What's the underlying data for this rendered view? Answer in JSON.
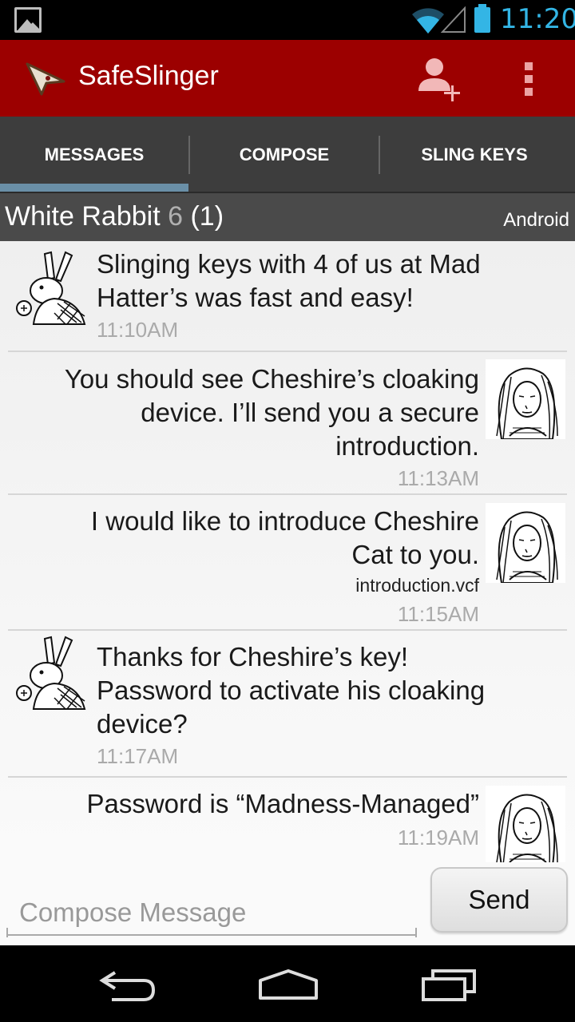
{
  "status_bar": {
    "time": "11:20"
  },
  "action_bar": {
    "title": "SafeSlinger"
  },
  "tabs": [
    {
      "label": "MESSAGES",
      "selected": true
    },
    {
      "label": "COMPOSE",
      "selected": false
    },
    {
      "label": "SLING KEYS",
      "selected": false
    }
  ],
  "recipient": {
    "name": "White Rabbit",
    "count": "6",
    "unread": "(1)",
    "platform": "Android"
  },
  "messages": [
    {
      "direction": "incoming",
      "text_lines": [
        "Slinging keys with 4 of us at Mad",
        "Hatter’s was fast and easy!"
      ],
      "time": "11:10AM"
    },
    {
      "direction": "outgoing",
      "text_lines": [
        "You should see Cheshire’s cloaking",
        "device. I’ll send you a secure",
        "introduction."
      ],
      "time": "11:13AM"
    },
    {
      "direction": "outgoing",
      "text_lines": [
        "I would like to introduce Cheshire",
        "Cat to you."
      ],
      "attachment": "introduction.vcf",
      "time": "11:15AM"
    },
    {
      "direction": "incoming",
      "text_lines": [
        "Thanks for Cheshire’s key!",
        "Password to activate his cloaking",
        "device?"
      ],
      "time": "11:17AM"
    },
    {
      "direction": "outgoing",
      "text_lines": [
        "Password is “Madness-Managed”"
      ],
      "time": "11:19AM"
    }
  ],
  "compose": {
    "placeholder": "Compose Message",
    "value": "",
    "send_label": "Send"
  },
  "colors": {
    "action_bar": "#9c0000",
    "tab_bar": "#3d3d3d",
    "tab_indicator": "#6a8fa7",
    "status_accent": "#33b5e5"
  },
  "icons": [
    "gallery-notification-icon",
    "wifi-icon",
    "signal-icon",
    "battery-icon",
    "app-logo-icon",
    "add-contact-icon",
    "overflow-menu-icon",
    "back-icon",
    "home-icon",
    "recent-apps-icon"
  ]
}
